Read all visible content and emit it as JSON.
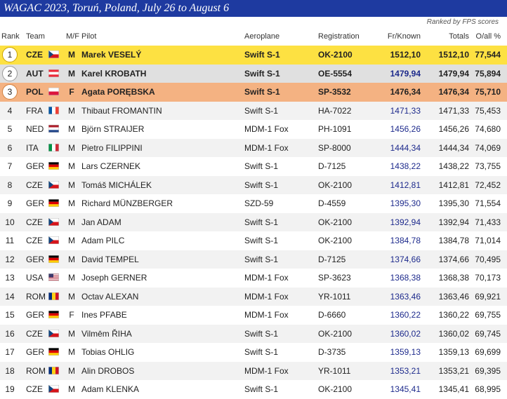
{
  "title": "WAGAC 2023, Toruń, Poland, July 26 to August 6",
  "note": "Ranked by FPS scores",
  "columns": {
    "rank": "Rank",
    "team": "Team",
    "mf": "M/F",
    "pilot": "Pilot",
    "plane": "Aeroplane",
    "reg": "Registration",
    "fr": "Fr/Known",
    "tot": "Totals",
    "pct": "O/all %"
  },
  "flag_colors": {
    "CZE": [
      "#ffffff",
      "#d7141a",
      "#11457e"
    ],
    "AUT": [
      "#ed2939",
      "#ffffff",
      "#ed2939"
    ],
    "POL": [
      "#ffffff",
      "#dc143c"
    ],
    "FRA": [
      "#0055a4",
      "#ffffff",
      "#ef4135"
    ],
    "NED": [
      "#ae1c28",
      "#ffffff",
      "#21468b"
    ],
    "ITA": [
      "#009246",
      "#ffffff",
      "#ce2b37"
    ],
    "GER": [
      "#000000",
      "#dd0000",
      "#ffce00"
    ],
    "USA": [
      "#b22234",
      "#ffffff",
      "#3c3b6e"
    ],
    "ROM": [
      "#002b7f",
      "#fcd116",
      "#ce1126"
    ]
  },
  "rows": [
    {
      "rank": "1",
      "team": "CZE",
      "mf": "M",
      "pilot": "Marek VESELÝ",
      "plane": "Swift S-1",
      "reg": "OK-2100",
      "fr": "1512,10",
      "tot": "1512,10",
      "pct": "77,544"
    },
    {
      "rank": "2",
      "team": "AUT",
      "mf": "M",
      "pilot": "Karel KROBATH",
      "plane": "Swift S-1",
      "reg": "OE-5554",
      "fr": "1479,94",
      "tot": "1479,94",
      "pct": "75,894"
    },
    {
      "rank": "3",
      "team": "POL",
      "mf": "F",
      "pilot": "Agata PORĘBSKA",
      "plane": "Swift S-1",
      "reg": "SP-3532",
      "fr": "1476,34",
      "tot": "1476,34",
      "pct": "75,710"
    },
    {
      "rank": "4",
      "team": "FRA",
      "mf": "M",
      "pilot": "Thibaut FROMANTIN",
      "plane": "Swift S-1",
      "reg": "HA-7022",
      "fr": "1471,33",
      "tot": "1471,33",
      "pct": "75,453"
    },
    {
      "rank": "5",
      "team": "NED",
      "mf": "M",
      "pilot": "Björn STRAIJER",
      "plane": "MDM-1 Fox",
      "reg": "PH-1091",
      "fr": "1456,26",
      "tot": "1456,26",
      "pct": "74,680"
    },
    {
      "rank": "6",
      "team": "ITA",
      "mf": "M",
      "pilot": "Pietro FILIPPINI",
      "plane": "MDM-1 Fox",
      "reg": "SP-8000",
      "fr": "1444,34",
      "tot": "1444,34",
      "pct": "74,069"
    },
    {
      "rank": "7",
      "team": "GER",
      "mf": "M",
      "pilot": "Lars CZERNEK",
      "plane": "Swift S-1",
      "reg": "D-7125",
      "fr": "1438,22",
      "tot": "1438,22",
      "pct": "73,755"
    },
    {
      "rank": "8",
      "team": "CZE",
      "mf": "M",
      "pilot": "Tomáš MICHÁLEK",
      "plane": "Swift S-1",
      "reg": "OK-2100",
      "fr": "1412,81",
      "tot": "1412,81",
      "pct": "72,452"
    },
    {
      "rank": "9",
      "team": "GER",
      "mf": "M",
      "pilot": "Richard MÜNZBERGER",
      "plane": "SZD-59",
      "reg": "D-4559",
      "fr": "1395,30",
      "tot": "1395,30",
      "pct": "71,554"
    },
    {
      "rank": "10",
      "team": "CZE",
      "mf": "M",
      "pilot": "Jan ADAM",
      "plane": "Swift S-1",
      "reg": "OK-2100",
      "fr": "1392,94",
      "tot": "1392,94",
      "pct": "71,433"
    },
    {
      "rank": "11",
      "team": "CZE",
      "mf": "M",
      "pilot": "Adam PILC",
      "plane": "Swift S-1",
      "reg": "OK-2100",
      "fr": "1384,78",
      "tot": "1384,78",
      "pct": "71,014"
    },
    {
      "rank": "12",
      "team": "GER",
      "mf": "M",
      "pilot": "David TEMPEL",
      "plane": "Swift S-1",
      "reg": "D-7125",
      "fr": "1374,66",
      "tot": "1374,66",
      "pct": "70,495"
    },
    {
      "rank": "13",
      "team": "USA",
      "mf": "M",
      "pilot": "Joseph GERNER",
      "plane": "MDM-1 Fox",
      "reg": "SP-3623",
      "fr": "1368,38",
      "tot": "1368,38",
      "pct": "70,173"
    },
    {
      "rank": "14",
      "team": "ROM",
      "mf": "M",
      "pilot": "Octav ALEXAN",
      "plane": "MDM-1 Fox",
      "reg": "YR-1011",
      "fr": "1363,46",
      "tot": "1363,46",
      "pct": "69,921"
    },
    {
      "rank": "15",
      "team": "GER",
      "mf": "F",
      "pilot": "Ines PFABE",
      "plane": "MDM-1 Fox",
      "reg": "D-6660",
      "fr": "1360,22",
      "tot": "1360,22",
      "pct": "69,755"
    },
    {
      "rank": "16",
      "team": "CZE",
      "mf": "M",
      "pilot": "Vilmēm ŘIHA",
      "plane": "Swift S-1",
      "reg": "OK-2100",
      "fr": "1360,02",
      "tot": "1360,02",
      "pct": "69,745"
    },
    {
      "rank": "17",
      "team": "GER",
      "mf": "M",
      "pilot": "Tobias OHLIG",
      "plane": "Swift S-1",
      "reg": "D-3735",
      "fr": "1359,13",
      "tot": "1359,13",
      "pct": "69,699"
    },
    {
      "rank": "18",
      "team": "ROM",
      "mf": "M",
      "pilot": "Alin DROBOS",
      "plane": "MDM-1 Fox",
      "reg": "YR-1011",
      "fr": "1353,21",
      "tot": "1353,21",
      "pct": "69,395"
    },
    {
      "rank": "19",
      "team": "CZE",
      "mf": "M",
      "pilot": "Adam KLENKA",
      "plane": "Swift S-1",
      "reg": "OK-2100",
      "fr": "1345,41",
      "tot": "1345,41",
      "pct": "68,995"
    }
  ]
}
